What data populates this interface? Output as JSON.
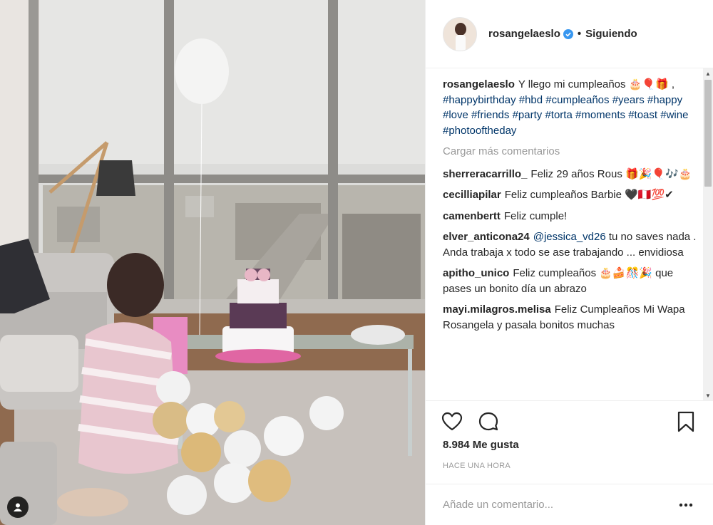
{
  "post": {
    "username": "rosangelaeslo",
    "follow_status": "Siguiendo",
    "separator": "•",
    "caption": {
      "username": "rosangelaeslo",
      "text": "Y llego mi cumpleaños 🎂🎈🎁 ,",
      "hashtags": [
        "#happybirthday",
        "#hbd",
        "#cumpleaños",
        "#years",
        "#happy",
        "#love",
        "#friends",
        "#party",
        "#torta",
        "#moments",
        "#toast",
        "#wine",
        "#photooftheday"
      ]
    },
    "load_more": "Cargar más comentarios",
    "comments": [
      {
        "user": "sherreracarrillo_",
        "text": "Feliz 29 años Rous 🎁🎉🎈🎶🎂"
      },
      {
        "user": "cecilliapilar",
        "text": "Feliz cumpleaños Barbie 🖤🇵🇪💯✔"
      },
      {
        "user": "camenbertt",
        "text": "Feliz cumple!"
      },
      {
        "user": "elver_anticona24",
        "mention": "@jessica_vd26",
        "text": "tu no saves nada . Anda trabaja x todo se ase trabajando ... envidiosa"
      },
      {
        "user": "apitho_unico",
        "text": "Feliz cumpleaños 🎂🍰🎊🎉 que pases un bonito día un abrazo"
      },
      {
        "user": "mayi.milagros.melisa",
        "text": "Feliz Cumpleaños Mi Wapa Rosangela y pasala bonitos muchas"
      }
    ],
    "likes": "8.984 Me gusta",
    "time": "HACE UNA HORA",
    "comment_placeholder": "Añade un comentario...",
    "icons": {
      "like": "heart-icon",
      "comment": "comment-icon",
      "save": "bookmark-icon",
      "more": "more-options-icon",
      "verified": "verified-badge-icon",
      "tag": "user-tag-icon"
    },
    "colors": {
      "hashtag": "#003569",
      "verified": "#3897f0",
      "muted": "#999999"
    }
  }
}
